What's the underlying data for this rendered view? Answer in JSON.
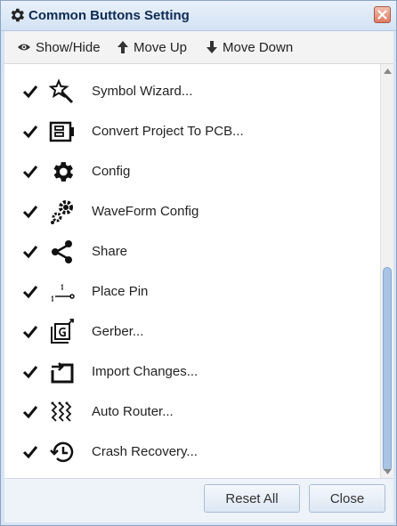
{
  "dialog": {
    "title": "Common Buttons Setting",
    "title_icon": "gear-icon",
    "close_icon": "close-icon"
  },
  "toolbar": {
    "show_hide": "Show/Hide",
    "move_up": "Move Up",
    "move_down": "Move Down"
  },
  "items": [
    {
      "label": "Symbol Wizard...",
      "checked": true,
      "icon": "magic-wand-icon"
    },
    {
      "label": "Convert Project To PCB...",
      "checked": true,
      "icon": "pcb-convert-icon"
    },
    {
      "label": "Config",
      "checked": true,
      "icon": "gear-icon"
    },
    {
      "label": "WaveForm Config",
      "checked": true,
      "icon": "gears-icon"
    },
    {
      "label": "Share",
      "checked": true,
      "icon": "share-icon"
    },
    {
      "label": "Place Pin",
      "checked": true,
      "icon": "pin-icon"
    },
    {
      "label": "Gerber...",
      "checked": true,
      "icon": "gerber-icon"
    },
    {
      "label": "Import Changes...",
      "checked": true,
      "icon": "import-icon"
    },
    {
      "label": "Auto Router...",
      "checked": true,
      "icon": "auto-router-icon"
    },
    {
      "label": "Crash Recovery...",
      "checked": true,
      "icon": "history-icon"
    }
  ],
  "footer": {
    "reset_all": "Reset All",
    "close": "Close"
  },
  "colors": {
    "titlebar": "#d3e2f3",
    "title_text": "#0e2a52",
    "close_button": "#e07a62",
    "scroll_thumb": "#a9c4e4"
  }
}
